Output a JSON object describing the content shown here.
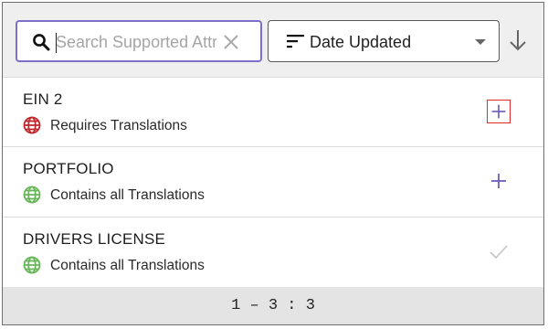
{
  "search": {
    "placeholder": "Search Supported Attributes",
    "value": ""
  },
  "sort": {
    "selected": "Date Updated",
    "direction": "descending"
  },
  "colors": {
    "accent": "#7d6fc7",
    "requires_translations": "#c0262b",
    "contains_all_translations": "#66b657",
    "highlight": "#e5292b"
  },
  "items": [
    {
      "name": "EIN 2",
      "status": "Requires Translations",
      "status_icon": "globe-icon",
      "action": "add-icon"
    },
    {
      "name": "PORTFOLIO",
      "status": "Contains all Translations",
      "status_icon": "globe-icon",
      "action": "add-icon"
    },
    {
      "name": "DRIVERS LICENSE",
      "status": "Contains all Translations",
      "status_icon": "globe-icon",
      "action": "check-icon"
    }
  ],
  "pagination": {
    "text": "1 – 3 : 3"
  }
}
